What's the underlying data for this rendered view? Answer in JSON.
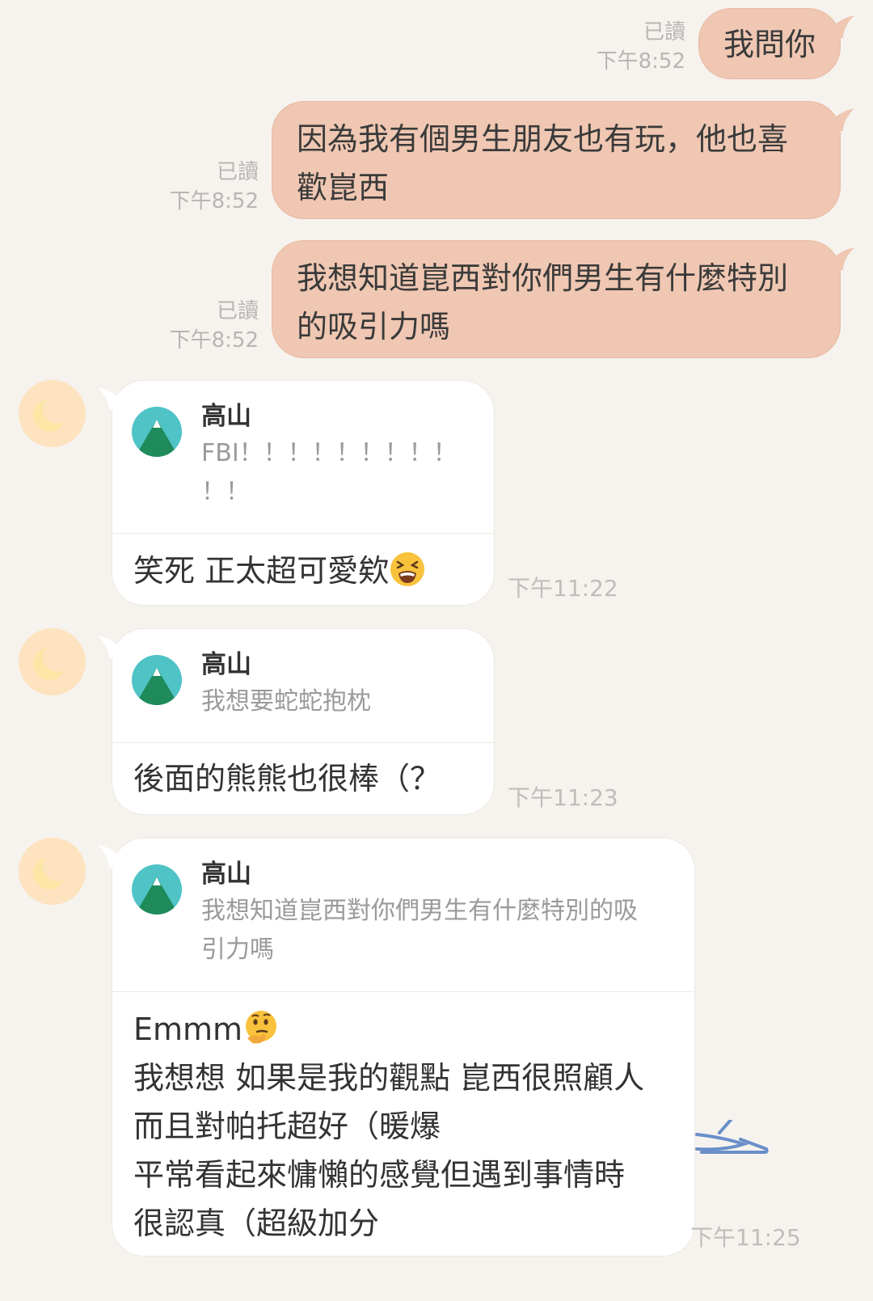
{
  "sent_messages": [
    {
      "read": "已讀",
      "time": "下午8:52",
      "lines": [
        "我問你"
      ]
    },
    {
      "read": "已讀",
      "time": "下午8:52",
      "lines": [
        "因為我有個男生朋友也有玩，他也喜",
        "歡崑西"
      ]
    },
    {
      "read": "已讀",
      "time": "下午8:52",
      "lines": [
        "我想知道崑西對你們男生有什麼特別",
        "的吸引力嗎"
      ]
    }
  ],
  "received_messages": [
    {
      "quote": {
        "name": "高山",
        "lines": [
          "FBI！！！！！！！！！",
          "！！"
        ]
      },
      "reply": {
        "lines": [
          "笑死 正太超可愛欸"
        ],
        "emoji": "tired-face-emoji"
      },
      "time": "下午11:22"
    },
    {
      "quote": {
        "name": "高山",
        "lines": [
          "我想要蛇蛇抱枕"
        ]
      },
      "reply": {
        "lines": [
          "後面的熊熊也很棒（？"
        ]
      },
      "time": "下午11:23"
    },
    {
      "quote": {
        "name": "高山",
        "lines": [
          "我想知道崑西對你們男生有什麼特別的吸",
          "引力嗎"
        ]
      },
      "reply": {
        "first_line": "Emmm",
        "emoji": "thinking-face-emoji",
        "lines": [
          "我想想 如果是我的觀點 崑西很照顧人",
          "而且對帕托超好（暖爆",
          "平常看起來慵懶的感覺但遇到事情時",
          "很認真（超級加分"
        ]
      },
      "time": "下午11:25"
    }
  ],
  "colors": {
    "background": "#f6f3ef",
    "sent_bubble": "#efc7b2",
    "received_bubble": "#ffffff",
    "avatar_bg": "#fde3bf",
    "avatar_moon": "#fbe6a6",
    "quote_avatar_top": "#4fc3c6",
    "quote_avatar_mountain": "#1f8a5a",
    "meta_text": "#b8b6b2"
  },
  "icons": {
    "received_avatar": "crescent-moon-avatar-icon",
    "quote_avatar": "mountain-avatar-icon",
    "decoration": "paper-plane-doodle-icon"
  }
}
